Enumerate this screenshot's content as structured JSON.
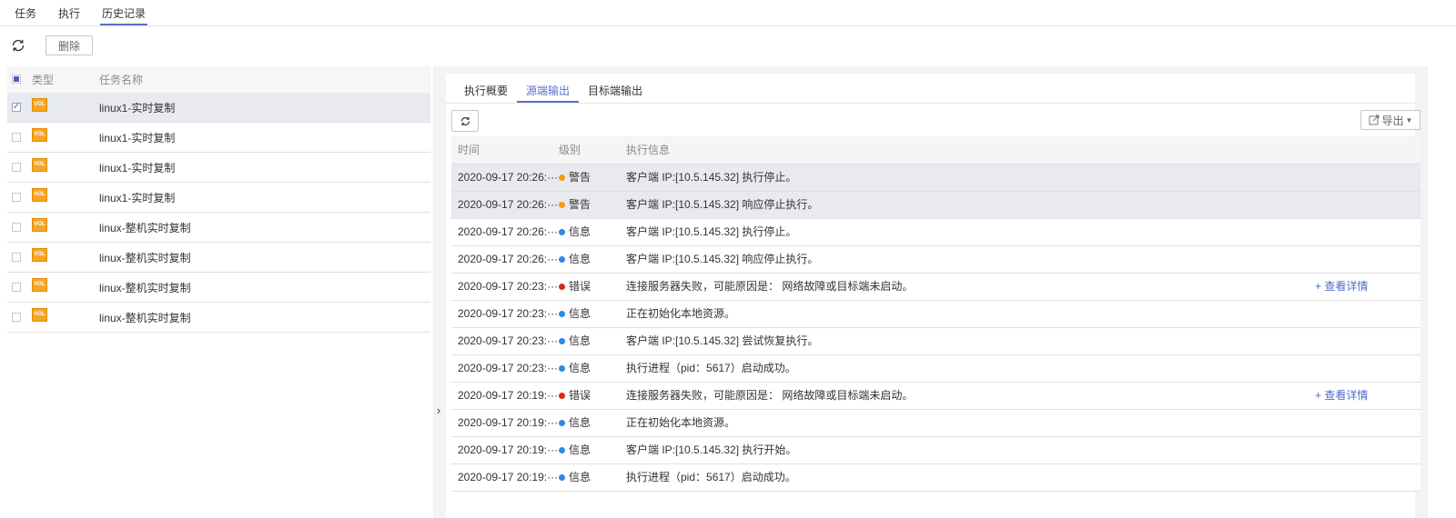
{
  "top_tabs": [
    {
      "label": "任务",
      "active": false
    },
    {
      "label": "执行",
      "active": false
    },
    {
      "label": "历史记录",
      "active": true
    }
  ],
  "toolbar": {
    "delete_label": "删除"
  },
  "left_table": {
    "headers": {
      "type": "类型",
      "name": "任务名称"
    },
    "rows": [
      {
        "type_icon": "VOL",
        "name": "linux1-实时复制",
        "checked": true
      },
      {
        "type_icon": "VOL",
        "name": "linux1-实时复制",
        "checked": false
      },
      {
        "type_icon": "VOL",
        "name": "linux1-实时复制",
        "checked": false
      },
      {
        "type_icon": "VOL",
        "name": "linux1-实时复制",
        "checked": false
      },
      {
        "type_icon": "VOL",
        "name": "linux-整机实时复制",
        "checked": false
      },
      {
        "type_icon": "VOL",
        "name": "linux-整机实时复制",
        "checked": false
      },
      {
        "type_icon": "VOL",
        "name": "linux-整机实时复制",
        "checked": false
      },
      {
        "type_icon": "VOL",
        "name": "linux-整机实时复制",
        "checked": false
      }
    ]
  },
  "right_panel": {
    "sub_tabs": [
      {
        "label": "执行概要",
        "active": false
      },
      {
        "label": "源端输出",
        "active": true
      },
      {
        "label": "目标端输出",
        "active": false
      }
    ],
    "export_label": "导出",
    "log_headers": {
      "time": "时间",
      "level": "级别",
      "message": "执行信息"
    },
    "level_colors": {
      "警告": "#f39c12",
      "信息": "#2d8ae3",
      "错误": "#d8281e"
    },
    "logs": [
      {
        "time": "2020-09-17 20:26:···",
        "level": "警告",
        "message": "客户端 IP:[10.5.145.32] 执行停止。",
        "link": ""
      },
      {
        "time": "2020-09-17 20:26:···",
        "level": "警告",
        "message": "客户端 IP:[10.5.145.32] 响应停止执行。",
        "link": ""
      },
      {
        "time": "2020-09-17 20:26:···",
        "level": "信息",
        "message": "客户端 IP:[10.5.145.32] 执行停止。",
        "link": ""
      },
      {
        "time": "2020-09-17 20:26:···",
        "level": "信息",
        "message": "客户端 IP:[10.5.145.32] 响应停止执行。",
        "link": ""
      },
      {
        "time": "2020-09-17 20:23:···",
        "level": "错误",
        "message": "连接服务器失败，可能原因是： 网络故障或目标端未启动。",
        "link": "+ 查看详情"
      },
      {
        "time": "2020-09-17 20:23:···",
        "level": "信息",
        "message": "正在初始化本地资源。",
        "link": ""
      },
      {
        "time": "2020-09-17 20:23:···",
        "level": "信息",
        "message": "客户端 IP:[10.5.145.32] 尝试恢复执行。",
        "link": ""
      },
      {
        "time": "2020-09-17 20:23:···",
        "level": "信息",
        "message": "执行进程（pid：5617）启动成功。",
        "link": ""
      },
      {
        "time": "2020-09-17 20:19:···",
        "level": "错误",
        "message": "连接服务器失败，可能原因是： 网络故障或目标端未启动。",
        "link": "+ 查看详情"
      },
      {
        "time": "2020-09-17 20:19:···",
        "level": "信息",
        "message": "正在初始化本地资源。",
        "link": ""
      },
      {
        "time": "2020-09-17 20:19:···",
        "level": "信息",
        "message": "客户端 IP:[10.5.145.32] 执行开始。",
        "link": ""
      },
      {
        "time": "2020-09-17 20:19:···",
        "level": "信息",
        "message": "执行进程（pid：5617）启动成功。",
        "link": ""
      }
    ]
  }
}
